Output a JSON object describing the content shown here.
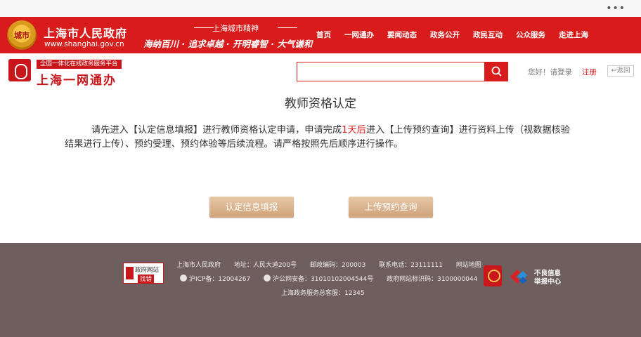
{
  "header": {
    "emblem_text": "城市",
    "gov_title": "上海市人民政府",
    "gov_url": "www.shanghai.gov.cn",
    "spirit_title": "上海城市精神",
    "spirit_text": "海纳百川 · 追求卓越 · 开明睿智 · 大气谦和",
    "nav": [
      "首页",
      "一网通办",
      "要闻动态",
      "政务公开",
      "政民互动",
      "公众服务",
      "走进上海"
    ]
  },
  "service": {
    "badge": "全国一体化在线政务服务平台",
    "name": "上海一网通办",
    "search_placeholder": "",
    "login_text": "您好！请登录",
    "register": "注册",
    "back": "↩返回"
  },
  "main": {
    "title": "教师资格认定",
    "instr_part1": "请先进入【认定信息填报】进行教师资格认定申请，申请完成",
    "instr_highlight": "1天后",
    "instr_part2": "进入【上传预约查询】进行资料上传（视数据核验结果进行上传）、预约受理、预约体验等后续流程。请严格按照先后顺序进行操作。",
    "button_fill": "认定信息填报",
    "button_upload": "上传预约查询"
  },
  "footer": {
    "find_error_line1": "政府网站",
    "find_error_line2": "找错",
    "row1": [
      "上海市人民政府",
      "地址：人民大道200号",
      "邮政编码：200003",
      "联系电话：23111111",
      "网站地图"
    ],
    "icp": "沪ICP备：12004267",
    "police": "沪公网安备：31010102004544号",
    "site_code": "政府网站标识码：3100000044",
    "hotline": "上海政务服务总客服：12345",
    "report_line1": "不良信息",
    "report_line2": "举报中心"
  },
  "colors": {
    "brand_red": "#d81c1c",
    "footer_bg": "#6f5e5e",
    "button_gold": "#d9b28c"
  }
}
